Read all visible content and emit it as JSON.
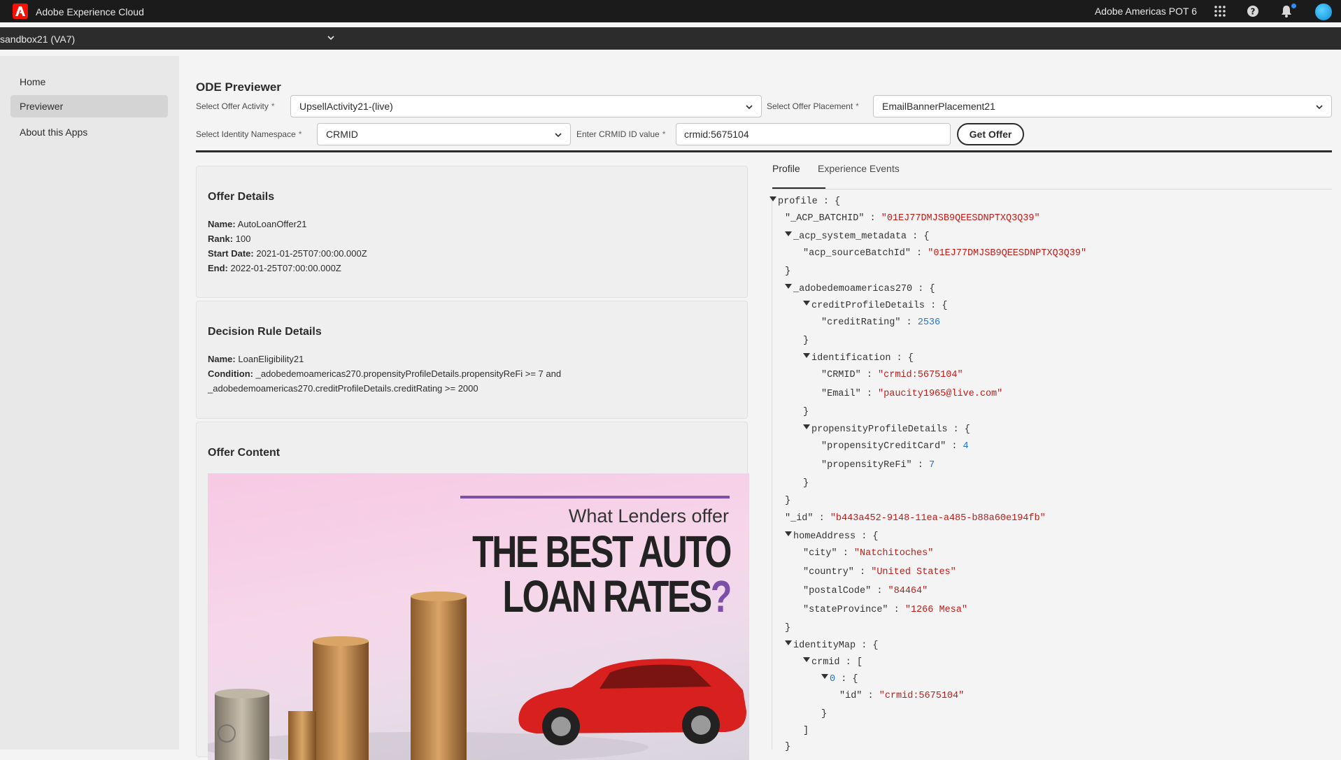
{
  "topbar": {
    "app_title": "Adobe Experience Cloud",
    "org_name": "Adobe Americas POT 6"
  },
  "sandbox": {
    "name": "sandbox21 (VA7)"
  },
  "sidebar": {
    "items": [
      {
        "label": "Home",
        "selected": false
      },
      {
        "label": "Previewer",
        "selected": true
      },
      {
        "label": "About this Apps",
        "selected": false
      }
    ]
  },
  "page": {
    "title": "ODE Previewer",
    "offer_activity": {
      "label": "Select Offer Activity",
      "value": "UpsellActivity21-(live)"
    },
    "offer_placement": {
      "label": "Select Offer Placement",
      "value": "EmailBannerPlacement21"
    },
    "identity_namespace": {
      "label": "Select Identity Namespace",
      "value": "CRMID"
    },
    "crmid": {
      "label": "Enter CRMID ID value",
      "value": "crmid:5675104"
    },
    "required_mark": "*",
    "get_offer_label": "Get Offer"
  },
  "offer_details": {
    "title": "Offer Details",
    "name_label": "Name:",
    "name": "AutoLoanOffer21",
    "rank_label": "Rank:",
    "rank": "100",
    "start_label": "Start Date:",
    "start": "2021-01-25T07:00:00.000Z",
    "end_label": "End:",
    "end": "2022-01-25T07:00:00.000Z"
  },
  "decision_rule": {
    "title": "Decision Rule Details",
    "name_label": "Name:",
    "name": "LoanEligibility21",
    "condition_label": "Condition:",
    "condition": "_adobedemoamericas270.propensityProfileDetails.propensityReFi >= 7 and _adobedemoamericas270.creditProfileDetails.creditRating >= 2000"
  },
  "offer_content": {
    "title": "Offer Content",
    "image": {
      "subheading": "What Lenders offer",
      "headline_1": "THE BEST AUTO",
      "headline_2": "LOAN RATES",
      "headline_mark": "?",
      "brand_color": "#7c4fa8"
    }
  },
  "tabs": [
    {
      "label": "Profile",
      "active": true
    },
    {
      "label": "Experience Events",
      "active": false
    }
  ],
  "profile_json": {
    "root_key": "profile",
    "acp_batchid_key": "\"_ACP_BATCHID\"",
    "acp_batchid": "\"01EJ77DMJSB9QEESDNPTXQ3Q39\"",
    "sys_meta_key": "_acp_system_metadata",
    "source_batch_key": "\"acp_sourceBatchId\"",
    "source_batch": "\"01EJ77DMJSB9QEESDNPTXQ3Q39\"",
    "tenant_key": "_adobedemoamericas270",
    "credit_details_key": "creditProfileDetails",
    "credit_rating_key": "\"creditRating\"",
    "credit_rating": "2536",
    "identification_key": "identification",
    "crmid_key": "\"CRMID\"",
    "crmid": "\"crmid:5675104\"",
    "email_key": "\"Email\"",
    "email": "\"paucity1965@live.com\"",
    "propensity_key": "propensityProfileDetails",
    "prop_cc_key": "\"propensityCreditCard\"",
    "prop_cc": "4",
    "prop_refi_key": "\"propensityReFi\"",
    "prop_refi": "7",
    "id_key": "\"_id\"",
    "id": "\"b443a452-9148-11ea-a485-b88a60e194fb\"",
    "home_key": "homeAddress",
    "city_key": "\"city\"",
    "city": "\"Natchitoches\"",
    "country_key": "\"country\"",
    "country": "\"United States\"",
    "postal_key": "\"postalCode\"",
    "postal": "\"84464\"",
    "state_key": "\"stateProvince\"",
    "state": "\"1266 Mesa\"",
    "identitymap_key": "identityMap",
    "crmid_arr_key": "crmid",
    "idx0_key": "0",
    "inner_id_key": "\"id\"",
    "inner_id": "\"crmid:5675104\""
  },
  "colors": {
    "json_string": "#c41a16",
    "json_number": "#1c74d4",
    "adobe_red": "#fa0f00"
  }
}
